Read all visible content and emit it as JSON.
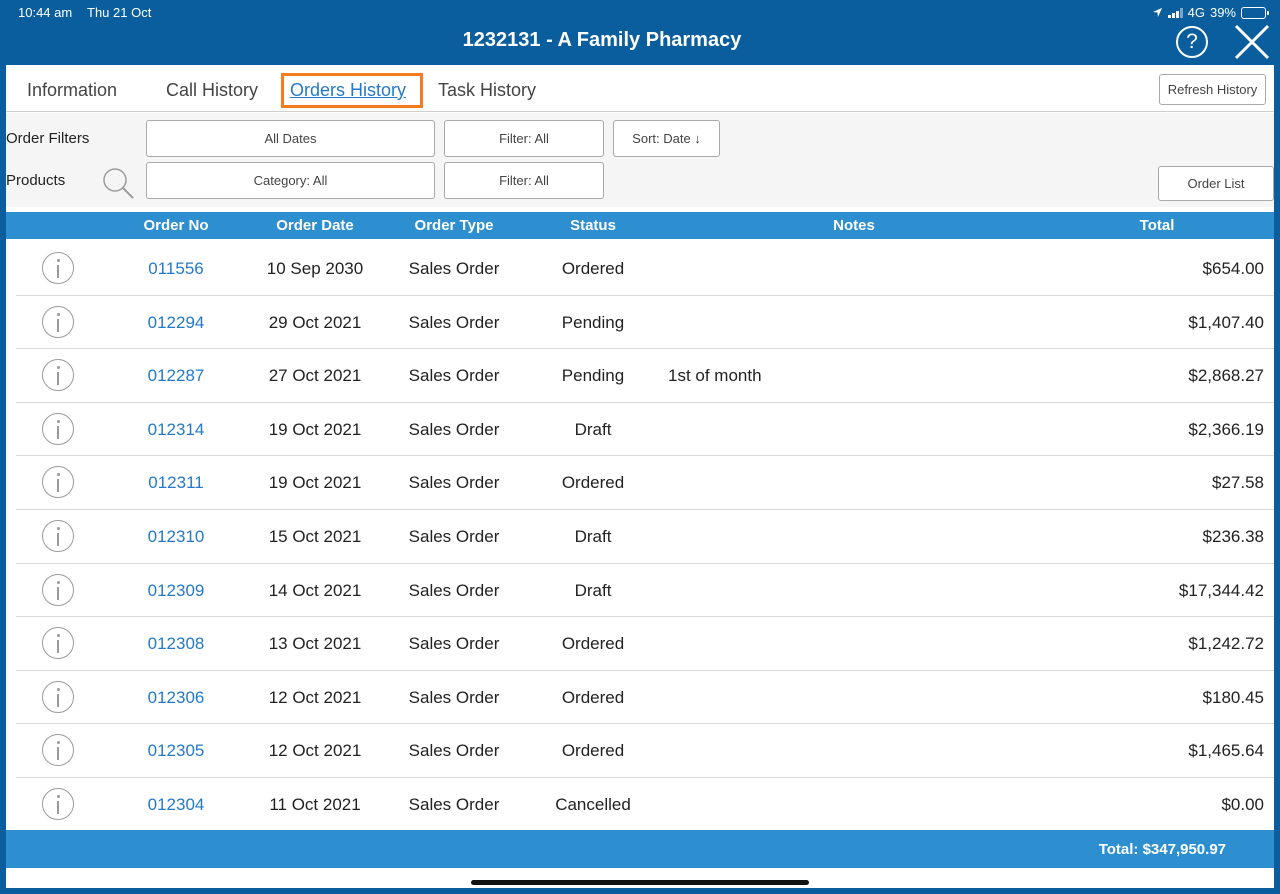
{
  "status": {
    "time": "10:44 am",
    "date": "Thu 21 Oct",
    "network": "4G",
    "battery": "39%",
    "battery_level": 0.39
  },
  "header": {
    "title": "1232131 - A Family Pharmacy",
    "help_label": "?"
  },
  "tabs": [
    {
      "label": "Information"
    },
    {
      "label": "Call History"
    },
    {
      "label": "Orders History"
    },
    {
      "label": "Task History"
    }
  ],
  "refresh_label": "Refresh History",
  "filters": {
    "order_filters_label": "Order Filters",
    "dates_label": "All Dates",
    "order_filter_label": "Filter: All",
    "sort_label": "Sort: Date ↓",
    "products_label": "Products",
    "category_label": "Category: All",
    "product_filter_label": "Filter: All",
    "order_list_label": "Order List"
  },
  "table": {
    "headers": {
      "order_no": "Order No",
      "order_date": "Order Date",
      "order_type": "Order Type",
      "status": "Status",
      "notes": "Notes",
      "total": "Total"
    },
    "rows": [
      {
        "no": "011556",
        "date": "10 Sep 2030",
        "type": "Sales Order",
        "status": "Ordered",
        "notes": "",
        "total": "$654.00"
      },
      {
        "no": "012294",
        "date": "29 Oct 2021",
        "type": "Sales Order",
        "status": "Pending",
        "notes": "",
        "total": "$1,407.40"
      },
      {
        "no": "012287",
        "date": "27 Oct 2021",
        "type": "Sales Order",
        "status": "Pending",
        "notes": "1st of month",
        "total": "$2,868.27"
      },
      {
        "no": "012314",
        "date": "19 Oct 2021",
        "type": "Sales Order",
        "status": "Draft",
        "notes": "",
        "total": "$2,366.19"
      },
      {
        "no": "012311",
        "date": "19 Oct 2021",
        "type": "Sales Order",
        "status": "Ordered",
        "notes": "",
        "total": "$27.58"
      },
      {
        "no": "012310",
        "date": "15 Oct 2021",
        "type": "Sales Order",
        "status": "Draft",
        "notes": "",
        "total": "$236.38"
      },
      {
        "no": "012309",
        "date": "14 Oct 2021",
        "type": "Sales Order",
        "status": "Draft",
        "notes": "",
        "total": "$17,344.42"
      },
      {
        "no": "012308",
        "date": "13 Oct 2021",
        "type": "Sales Order",
        "status": "Ordered",
        "notes": "",
        "total": "$1,242.72"
      },
      {
        "no": "012306",
        "date": "12 Oct 2021",
        "type": "Sales Order",
        "status": "Ordered",
        "notes": "",
        "total": "$180.45"
      },
      {
        "no": "012305",
        "date": "12 Oct 2021",
        "type": "Sales Order",
        "status": "Ordered",
        "notes": "",
        "total": "$1,465.64"
      },
      {
        "no": "012304",
        "date": "11 Oct 2021",
        "type": "Sales Order",
        "status": "Cancelled",
        "notes": "",
        "total": "$0.00"
      }
    ]
  },
  "footer": {
    "total_label": "Total: $347,950.97"
  },
  "colors": {
    "header_bg": "#0a5e9e",
    "table_header_bg": "#2d8fd0",
    "link": "#2479c9",
    "tab_highlight": "#f47c20"
  }
}
